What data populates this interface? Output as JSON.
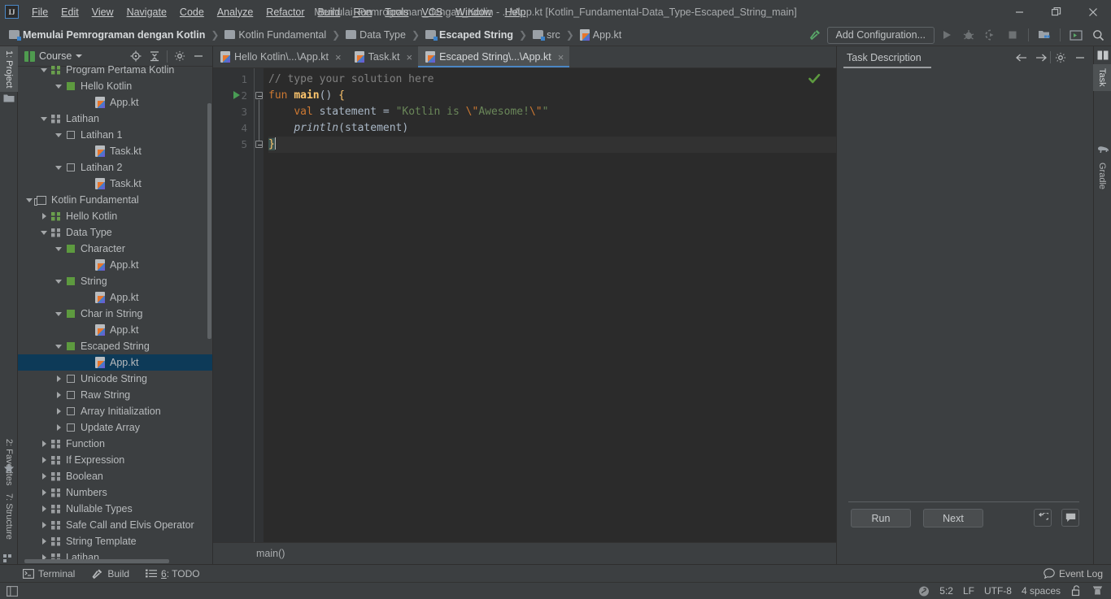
{
  "window": {
    "title": "Memulai_Pemrograman_dengan_Kotlin - ...\\App.kt [Kotlin_Fundamental-Data_Type-Escaped_String_main]",
    "logo": "IJ",
    "minimize": "minimize-icon",
    "maximize": "restore-icon",
    "close": "close-icon"
  },
  "menu": {
    "items": [
      {
        "label": "File"
      },
      {
        "label": "Edit"
      },
      {
        "label": "View"
      },
      {
        "label": "Navigate"
      },
      {
        "label": "Code"
      },
      {
        "label": "Analyze"
      },
      {
        "label": "Refactor"
      },
      {
        "label": "Build"
      },
      {
        "label": "Run"
      },
      {
        "label": "Tools"
      },
      {
        "label": "VCS"
      },
      {
        "label": "Window"
      },
      {
        "label": "Help"
      }
    ]
  },
  "breadcrumbs": {
    "separator": "❯",
    "items": [
      {
        "label": "Memulai Pemrograman dengan Kotlin",
        "icon": "module-icon",
        "bold": true
      },
      {
        "label": "Kotlin Fundamental",
        "icon": "folder-icon",
        "bold": false
      },
      {
        "label": "Data Type",
        "icon": "folder-icon",
        "bold": false
      },
      {
        "label": "Escaped String",
        "icon": "module-icon",
        "bold": true
      },
      {
        "label": "src",
        "icon": "module-icon",
        "bold": false
      },
      {
        "label": "App.kt",
        "icon": "kotlin-file-icon",
        "bold": false
      }
    ]
  },
  "toolbar": {
    "hammer_icon": "build-hammer-icon",
    "add_configuration": "Add Configuration...",
    "run_icon": "run-icon",
    "debug_icon": "debug-icon",
    "coverage_icon": "run-with-coverage-icon",
    "stop_icon": "stop-icon",
    "project_structure_icon": "project-structure-icon",
    "terminal_icon": "terminal-icon",
    "search_icon": "search-everywhere-icon"
  },
  "left_stripe": {
    "tabs": [
      {
        "label": "1: Project",
        "active": true
      },
      {
        "label": "2: Favorites",
        "active": false
      },
      {
        "label": "7: Structure",
        "active": false
      }
    ]
  },
  "right_stripe": {
    "tabs": [
      {
        "label": "Task",
        "active": true,
        "icon": "book-icon"
      },
      {
        "label": "Gradle",
        "active": false,
        "icon": "gradle-elephant-icon"
      }
    ]
  },
  "project_panel": {
    "title": "Course",
    "title_icon": "course-book-icon",
    "tools": [
      {
        "name": "scroll-from-source-icon"
      },
      {
        "name": "collapse-all-icon"
      },
      {
        "name": "settings-gear-icon"
      },
      {
        "name": "hide-panel-icon"
      }
    ],
    "tree": [
      {
        "label": "Program Pertama Kotlin",
        "indent": 1,
        "twisty": "down",
        "icon": "lesson-green-icon",
        "selected": false,
        "clipped": true
      },
      {
        "label": "Hello Kotlin",
        "indent": 2,
        "twisty": "down",
        "icon": "task-done-icon",
        "selected": false
      },
      {
        "label": "App.kt",
        "indent": 4,
        "twisty": "none",
        "icon": "kotlin-file-icon",
        "selected": false
      },
      {
        "label": "Latihan",
        "indent": 1,
        "twisty": "down",
        "icon": "lesson-gray-icon",
        "selected": false
      },
      {
        "label": "Latihan 1",
        "indent": 2,
        "twisty": "down",
        "icon": "task-todo-icon",
        "selected": false
      },
      {
        "label": "Task.kt",
        "indent": 4,
        "twisty": "none",
        "icon": "kotlin-file-icon",
        "selected": false
      },
      {
        "label": "Latihan 2",
        "indent": 2,
        "twisty": "down",
        "icon": "task-todo-icon",
        "selected": false
      },
      {
        "label": "Task.kt",
        "indent": 4,
        "twisty": "none",
        "icon": "kotlin-file-icon",
        "selected": false
      },
      {
        "label": "Kotlin Fundamental",
        "indent": 0,
        "twisty": "down",
        "icon": "course-section-icon",
        "selected": false
      },
      {
        "label": "Hello Kotlin",
        "indent": 1,
        "twisty": "right",
        "icon": "lesson-green-icon",
        "selected": false
      },
      {
        "label": "Data Type",
        "indent": 1,
        "twisty": "down",
        "icon": "lesson-gray-icon",
        "selected": false
      },
      {
        "label": "Character",
        "indent": 2,
        "twisty": "down",
        "icon": "task-done-icon",
        "selected": false
      },
      {
        "label": "App.kt",
        "indent": 4,
        "twisty": "none",
        "icon": "kotlin-file-icon",
        "selected": false
      },
      {
        "label": "String",
        "indent": 2,
        "twisty": "down",
        "icon": "task-done-icon",
        "selected": false
      },
      {
        "label": "App.kt",
        "indent": 4,
        "twisty": "none",
        "icon": "kotlin-file-icon",
        "selected": false
      },
      {
        "label": "Char in String",
        "indent": 2,
        "twisty": "down",
        "icon": "task-done-icon",
        "selected": false
      },
      {
        "label": "App.kt",
        "indent": 4,
        "twisty": "none",
        "icon": "kotlin-file-icon",
        "selected": false
      },
      {
        "label": "Escaped String",
        "indent": 2,
        "twisty": "down",
        "icon": "task-done-icon",
        "selected": false
      },
      {
        "label": "App.kt",
        "indent": 4,
        "twisty": "none",
        "icon": "kotlin-file-icon",
        "selected": true
      },
      {
        "label": "Unicode String",
        "indent": 2,
        "twisty": "right",
        "icon": "task-todo-icon",
        "selected": false
      },
      {
        "label": "Raw String",
        "indent": 2,
        "twisty": "right",
        "icon": "task-todo-icon",
        "selected": false
      },
      {
        "label": "Array Initialization",
        "indent": 2,
        "twisty": "right",
        "icon": "task-todo-icon",
        "selected": false
      },
      {
        "label": "Update Array",
        "indent": 2,
        "twisty": "right",
        "icon": "task-todo-icon",
        "selected": false
      },
      {
        "label": "Function",
        "indent": 1,
        "twisty": "right",
        "icon": "lesson-gray-icon",
        "selected": false
      },
      {
        "label": "If Expression",
        "indent": 1,
        "twisty": "right",
        "icon": "lesson-gray-icon",
        "selected": false
      },
      {
        "label": "Boolean",
        "indent": 1,
        "twisty": "right",
        "icon": "lesson-gray-icon",
        "selected": false
      },
      {
        "label": "Numbers",
        "indent": 1,
        "twisty": "right",
        "icon": "lesson-gray-icon",
        "selected": false
      },
      {
        "label": "Nullable Types",
        "indent": 1,
        "twisty": "right",
        "icon": "lesson-gray-icon",
        "selected": false
      },
      {
        "label": "Safe Call and Elvis Operator",
        "indent": 1,
        "twisty": "right",
        "icon": "lesson-gray-icon",
        "selected": false
      },
      {
        "label": "String Template",
        "indent": 1,
        "twisty": "right",
        "icon": "lesson-gray-icon",
        "selected": false
      },
      {
        "label": "Latihan",
        "indent": 1,
        "twisty": "right",
        "icon": "lesson-gray-icon",
        "selected": false,
        "clipped": true
      }
    ]
  },
  "editor": {
    "tabs": [
      {
        "label": "Hello Kotlin\\...\\App.kt",
        "active": false,
        "close": "×"
      },
      {
        "label": "Task.kt",
        "active": false,
        "close": "×"
      },
      {
        "label": "Escaped String\\...\\App.kt",
        "active": true,
        "close": "×"
      }
    ],
    "line_numbers": [
      "1",
      "2",
      "3",
      "4",
      "5"
    ],
    "code": {
      "line1_comment": "// type your solution here",
      "line2_kw": "fun ",
      "line2_fn": "main",
      "line2_parens": "()",
      "line2_brace": " {",
      "line3_indent": "    ",
      "line3_kw": "val ",
      "line3_ident": "statement",
      "line3_eq": " = ",
      "line3_str1": "\"Kotlin is ",
      "line3_esc1": "\\\"",
      "line3_str2": "Awesome!",
      "line3_esc2": "\\\"",
      "line3_str3": "\"",
      "line4_indent": "    ",
      "line4_fn": "println",
      "line4_open": "(",
      "line4_arg": "statement",
      "line4_close": ")",
      "line5_brace": "}"
    },
    "inspection_status": "inspections-ok-check-icon",
    "breadcrumb": "main()"
  },
  "task_panel": {
    "tab_label": "Task Description",
    "prev_icon": "previous-task-icon",
    "next_icon": "next-task-icon",
    "settings_icon": "settings-gear-icon",
    "hide_icon": "hide-panel-icon",
    "run_button": "Run",
    "next_button": "Next",
    "reset_icon": "reset-task-icon",
    "comment_icon": "leave-comment-icon",
    "content": ""
  },
  "bottom_stripe": {
    "items": [
      {
        "label": "Terminal",
        "icon": "terminal-icon"
      },
      {
        "label": "Build",
        "icon": "build-hammer-icon"
      },
      {
        "label": "6: TODO",
        "icon": "todo-list-icon"
      }
    ],
    "event_log": "Event Log",
    "event_log_icon": "event-log-icon"
  },
  "statusbar": {
    "toggle_icon": "toggle-toolwindow-icon",
    "sync_icon": "gradle-sync-icon",
    "caret_position": "5:2",
    "line_separator": "LF",
    "encoding": "UTF-8",
    "indent": "4 spaces",
    "lock_icon": "read-write-lock-icon",
    "inspection_icon": "inspection-profile-icon"
  },
  "colors": {
    "bg_panel": "#3c3f41",
    "bg_editor": "#2b2b2b",
    "accent_blue": "#4b86c4",
    "selection_blue": "#0d3a58",
    "green_run": "#499c54",
    "string_green": "#6a8759",
    "keyword_orange": "#cc7832",
    "function_yellow": "#ffc66d",
    "identifier": "#a9b7c6"
  }
}
